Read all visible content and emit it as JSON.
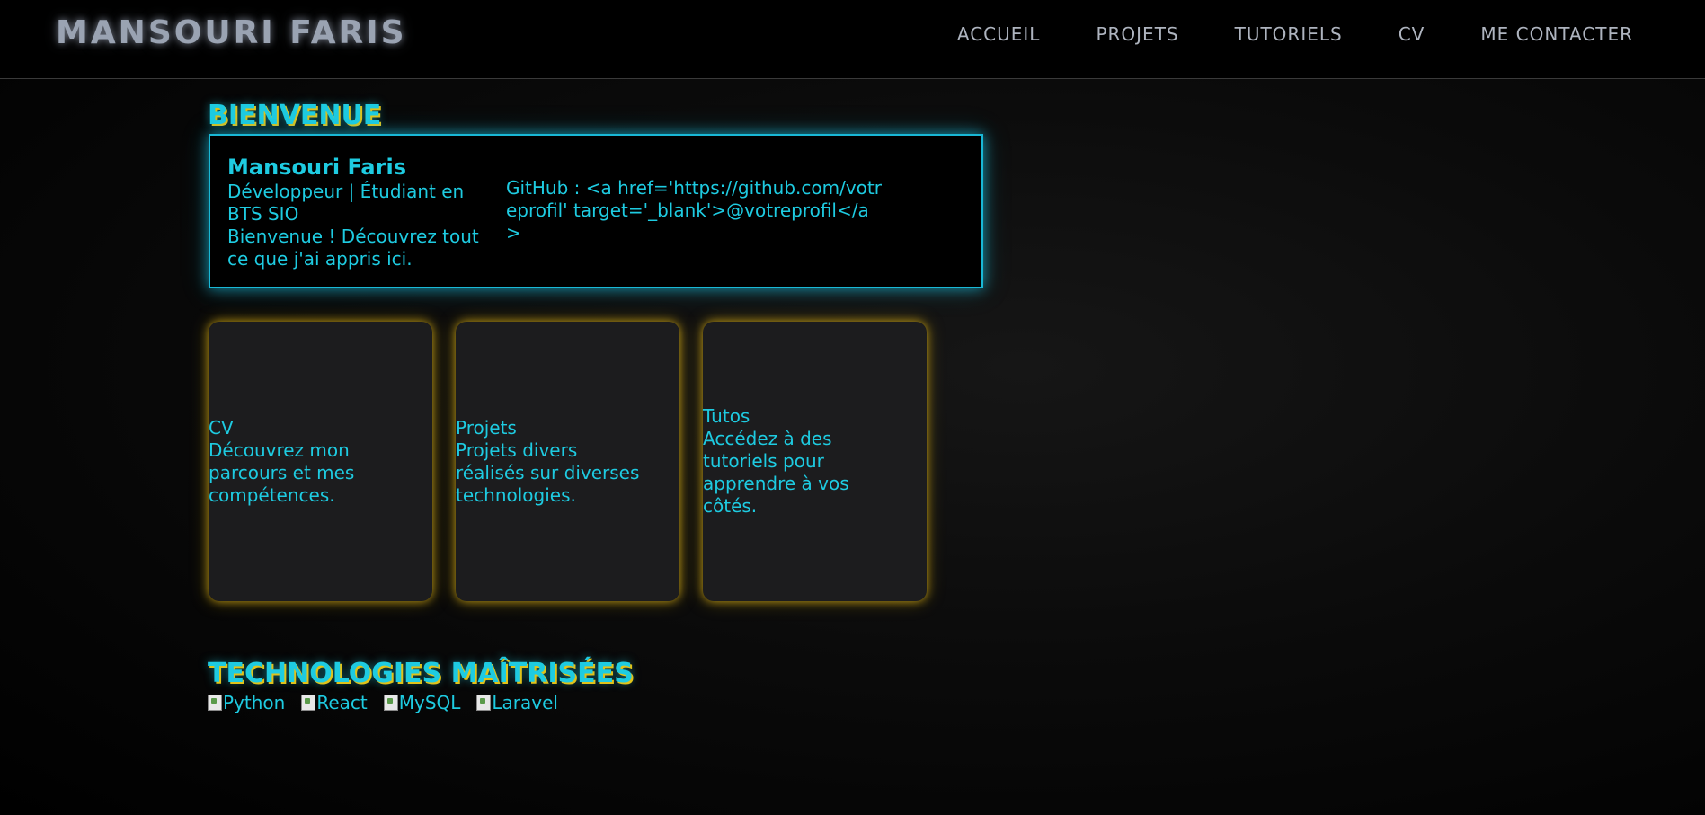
{
  "header": {
    "brand": "MANSOURI FARIS",
    "nav": [
      "ACCUEIL",
      "PROJETS",
      "TUTORIELS",
      "CV",
      "ME CONTACTER"
    ]
  },
  "welcome": {
    "title": "BIENVENUE",
    "name": "Mansouri Faris",
    "role": "Développeur | Étudiant en BTS SIO",
    "intro": "Bienvenue ! Découvrez tout ce que j'ai appris ici.",
    "github": "GitHub : <a href='https://github.com/votreprofil' target='_blank'>@votreprofil</a>"
  },
  "cards": [
    {
      "title": "CV",
      "desc": "Découvrez mon parcours et mes compétences."
    },
    {
      "title": "Projets",
      "desc": "Projets divers réalisés sur diverses technologies."
    },
    {
      "title": "Tutos",
      "desc": "Accédez à des tutoriels pour apprendre à vos côtés."
    }
  ],
  "technologies": {
    "title": "TECHNOLOGIES MAÎTRISÉES",
    "items": [
      "Python",
      "React",
      "MySQL",
      "Laravel"
    ]
  },
  "colors": {
    "accent": "#1ecbe1",
    "glow_gold": "#e0b414",
    "nav_text": "#aeb4bf",
    "background": "#000000"
  }
}
